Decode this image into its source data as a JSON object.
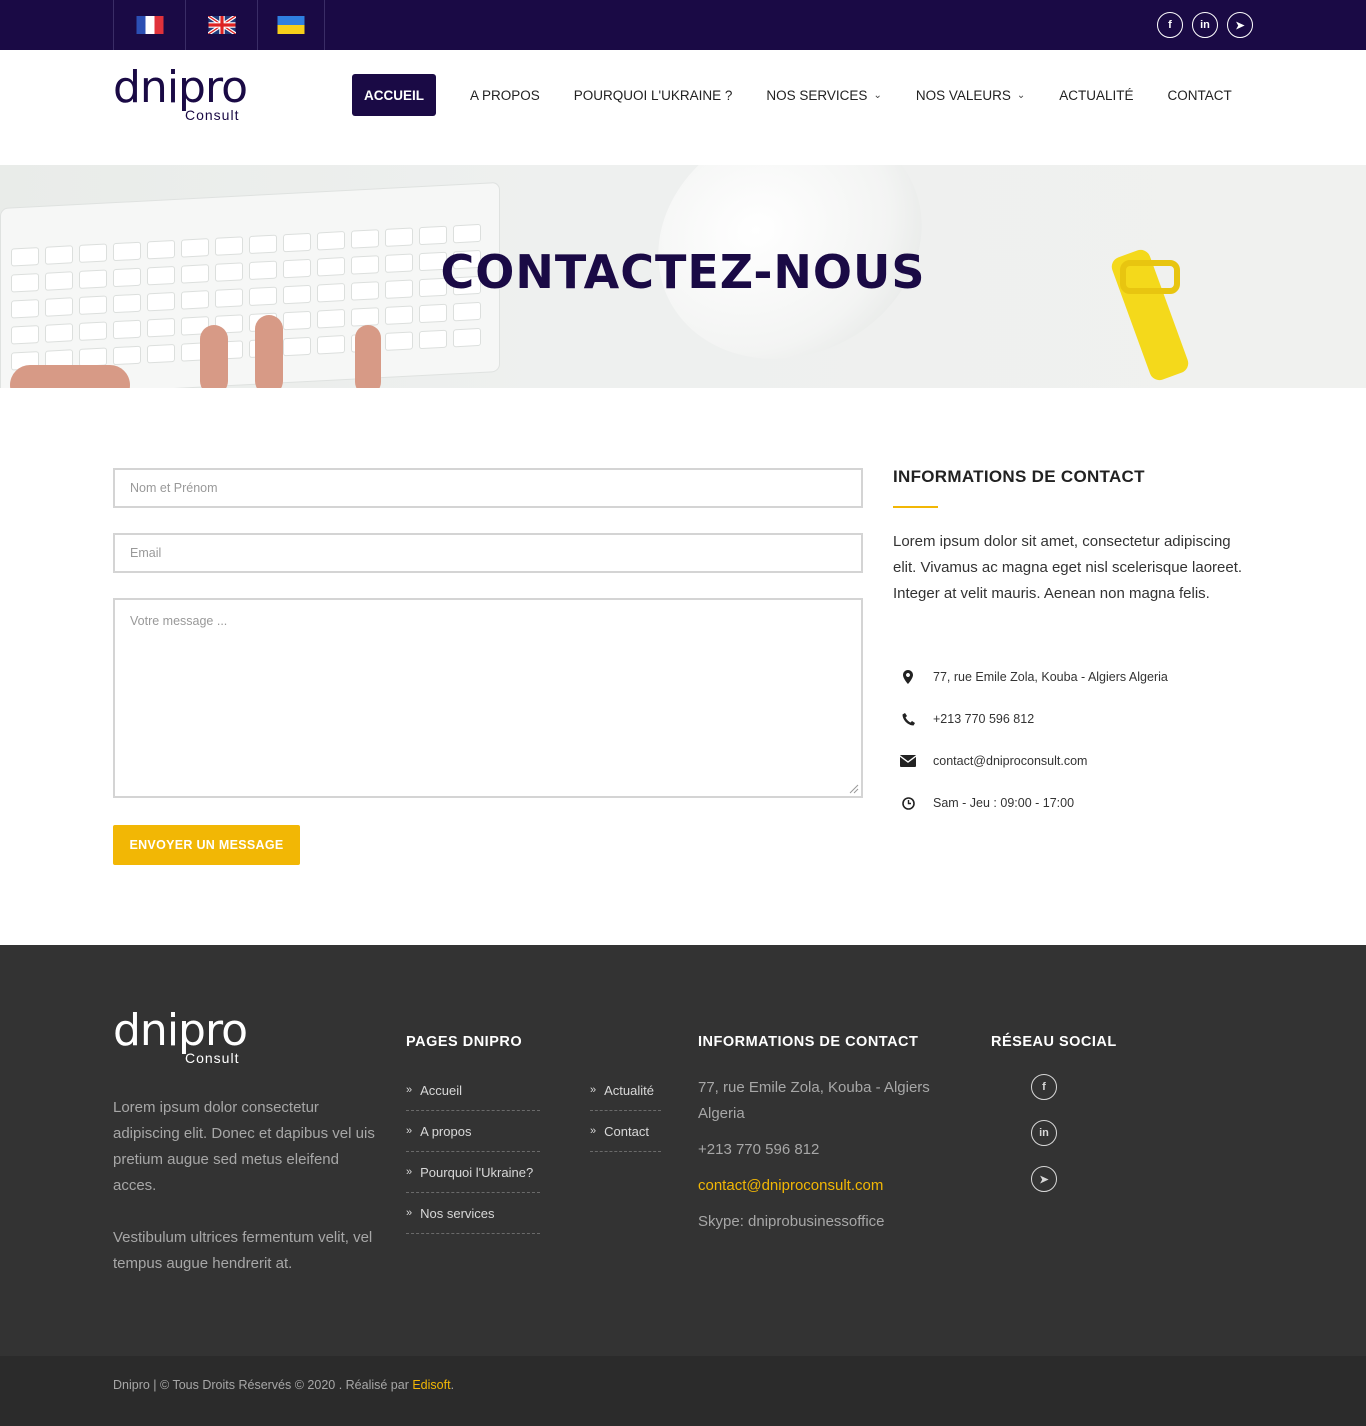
{
  "topbar": {
    "languages": [
      {
        "name": "French",
        "code": "fr"
      },
      {
        "name": "English",
        "code": "en"
      },
      {
        "name": "Ukrainian",
        "code": "ua"
      }
    ],
    "social": [
      {
        "icon": "facebook-icon",
        "glyph": "f"
      },
      {
        "icon": "linkedin-icon",
        "glyph": "in"
      },
      {
        "icon": "telegram-icon",
        "glyph": "➤"
      }
    ]
  },
  "brand": {
    "logo_main": "dnipro",
    "logo_sub": "Consult"
  },
  "nav": {
    "items": [
      {
        "label": "ACCUEIL",
        "active": true,
        "dropdown": false
      },
      {
        "label": "A PROPOS",
        "active": false,
        "dropdown": false
      },
      {
        "label": "POURQUOI L'UKRAINE ?",
        "active": false,
        "dropdown": false
      },
      {
        "label": "NOS SERVICES",
        "active": false,
        "dropdown": true
      },
      {
        "label": "NOS VALEURS",
        "active": false,
        "dropdown": true
      },
      {
        "label": "ACTUALITÉ",
        "active": false,
        "dropdown": false
      },
      {
        "label": "CONTACT",
        "active": false,
        "dropdown": false
      }
    ]
  },
  "hero": {
    "title": "CONTACTEZ-NOUS"
  },
  "form": {
    "name_placeholder": "Nom et Prénom",
    "email_placeholder": "Email",
    "message_placeholder": "Votre message ...",
    "submit_label": "ENVOYER UN MESSAGE"
  },
  "contact_info": {
    "title": "INFORMATIONS DE CONTACT",
    "description": "Lorem ipsum dolor sit amet, consectetur adipiscing elit. Vivamus ac magna eget nisl scelerisque laoreet. Integer at velit mauris. Aenean non magna felis.",
    "address": "77, rue Emile Zola, Kouba - Algiers Algeria",
    "phone": "+213 770 596 812",
    "email": "contact@dniproconsult.com",
    "hours": "Sam - Jeu : 09:00 - 17:00"
  },
  "footer": {
    "about_p1": "Lorem ipsum dolor consectetur adipiscing elit. Donec et dapibus vel uis pretium augue sed metus eleifend acces.",
    "about_p2": "Vestibulum ultrices fermentum velit, vel tempus augue hendrerit at.",
    "pages_title": "PAGES DNIPRO",
    "pages_col1": [
      "Accueil",
      "A propos",
      "Pourquoi l'Ukraine?",
      "Nos services"
    ],
    "pages_col2": [
      "Actualité",
      "Contact"
    ],
    "contact_title": "INFORMATIONS DE CONTACT",
    "address": "77, rue Emile Zola, Kouba - Algiers Algeria",
    "phone": "+213 770 596 812",
    "email": "contact@dniproconsult.com",
    "skype": "Skype: dniprobusinessoffice",
    "social_title": "RÉSEAU SOCIAL",
    "social": [
      {
        "icon": "facebook-icon",
        "glyph": "f"
      },
      {
        "icon": "linkedin-icon",
        "glyph": "in"
      },
      {
        "icon": "telegram-icon",
        "glyph": "➤"
      }
    ]
  },
  "copyright": {
    "text": "Dnipro | © Tous Droits Réservés © 2020 . Réalisé par ",
    "brand": "Edisoft",
    "suffix": "."
  },
  "colors": {
    "primary": "#1a0a45",
    "accent": "#f2b705",
    "footer_bg": "#333333"
  }
}
